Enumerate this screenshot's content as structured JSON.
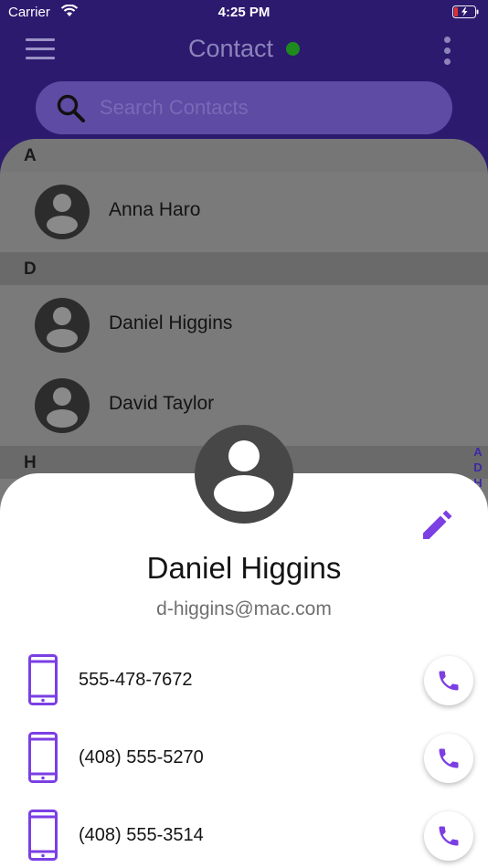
{
  "status_bar": {
    "carrier": "Carrier",
    "time": "4:25 PM"
  },
  "header": {
    "title": "Contact",
    "online_color": "#1e8a1e"
  },
  "search": {
    "placeholder": "Search Contacts",
    "icon": "search-icon"
  },
  "sections": [
    {
      "letter": "A",
      "contacts": [
        {
          "name": "Anna Haro"
        }
      ]
    },
    {
      "letter": "D",
      "contacts": [
        {
          "name": "Daniel Higgins"
        },
        {
          "name": "David Taylor"
        }
      ]
    },
    {
      "letter": "H",
      "contacts": []
    }
  ],
  "index_letters": [
    "A",
    "D",
    "H"
  ],
  "detail": {
    "name": "Daniel Higgins",
    "email": "d-higgins@mac.com",
    "phones": [
      {
        "number": "555-478-7672"
      },
      {
        "number": "(408) 555-5270"
      },
      {
        "number": "(408) 555-3514"
      }
    ]
  },
  "colors": {
    "accent": "#7b3fe4",
    "header_bg": "#2c1a6f"
  }
}
